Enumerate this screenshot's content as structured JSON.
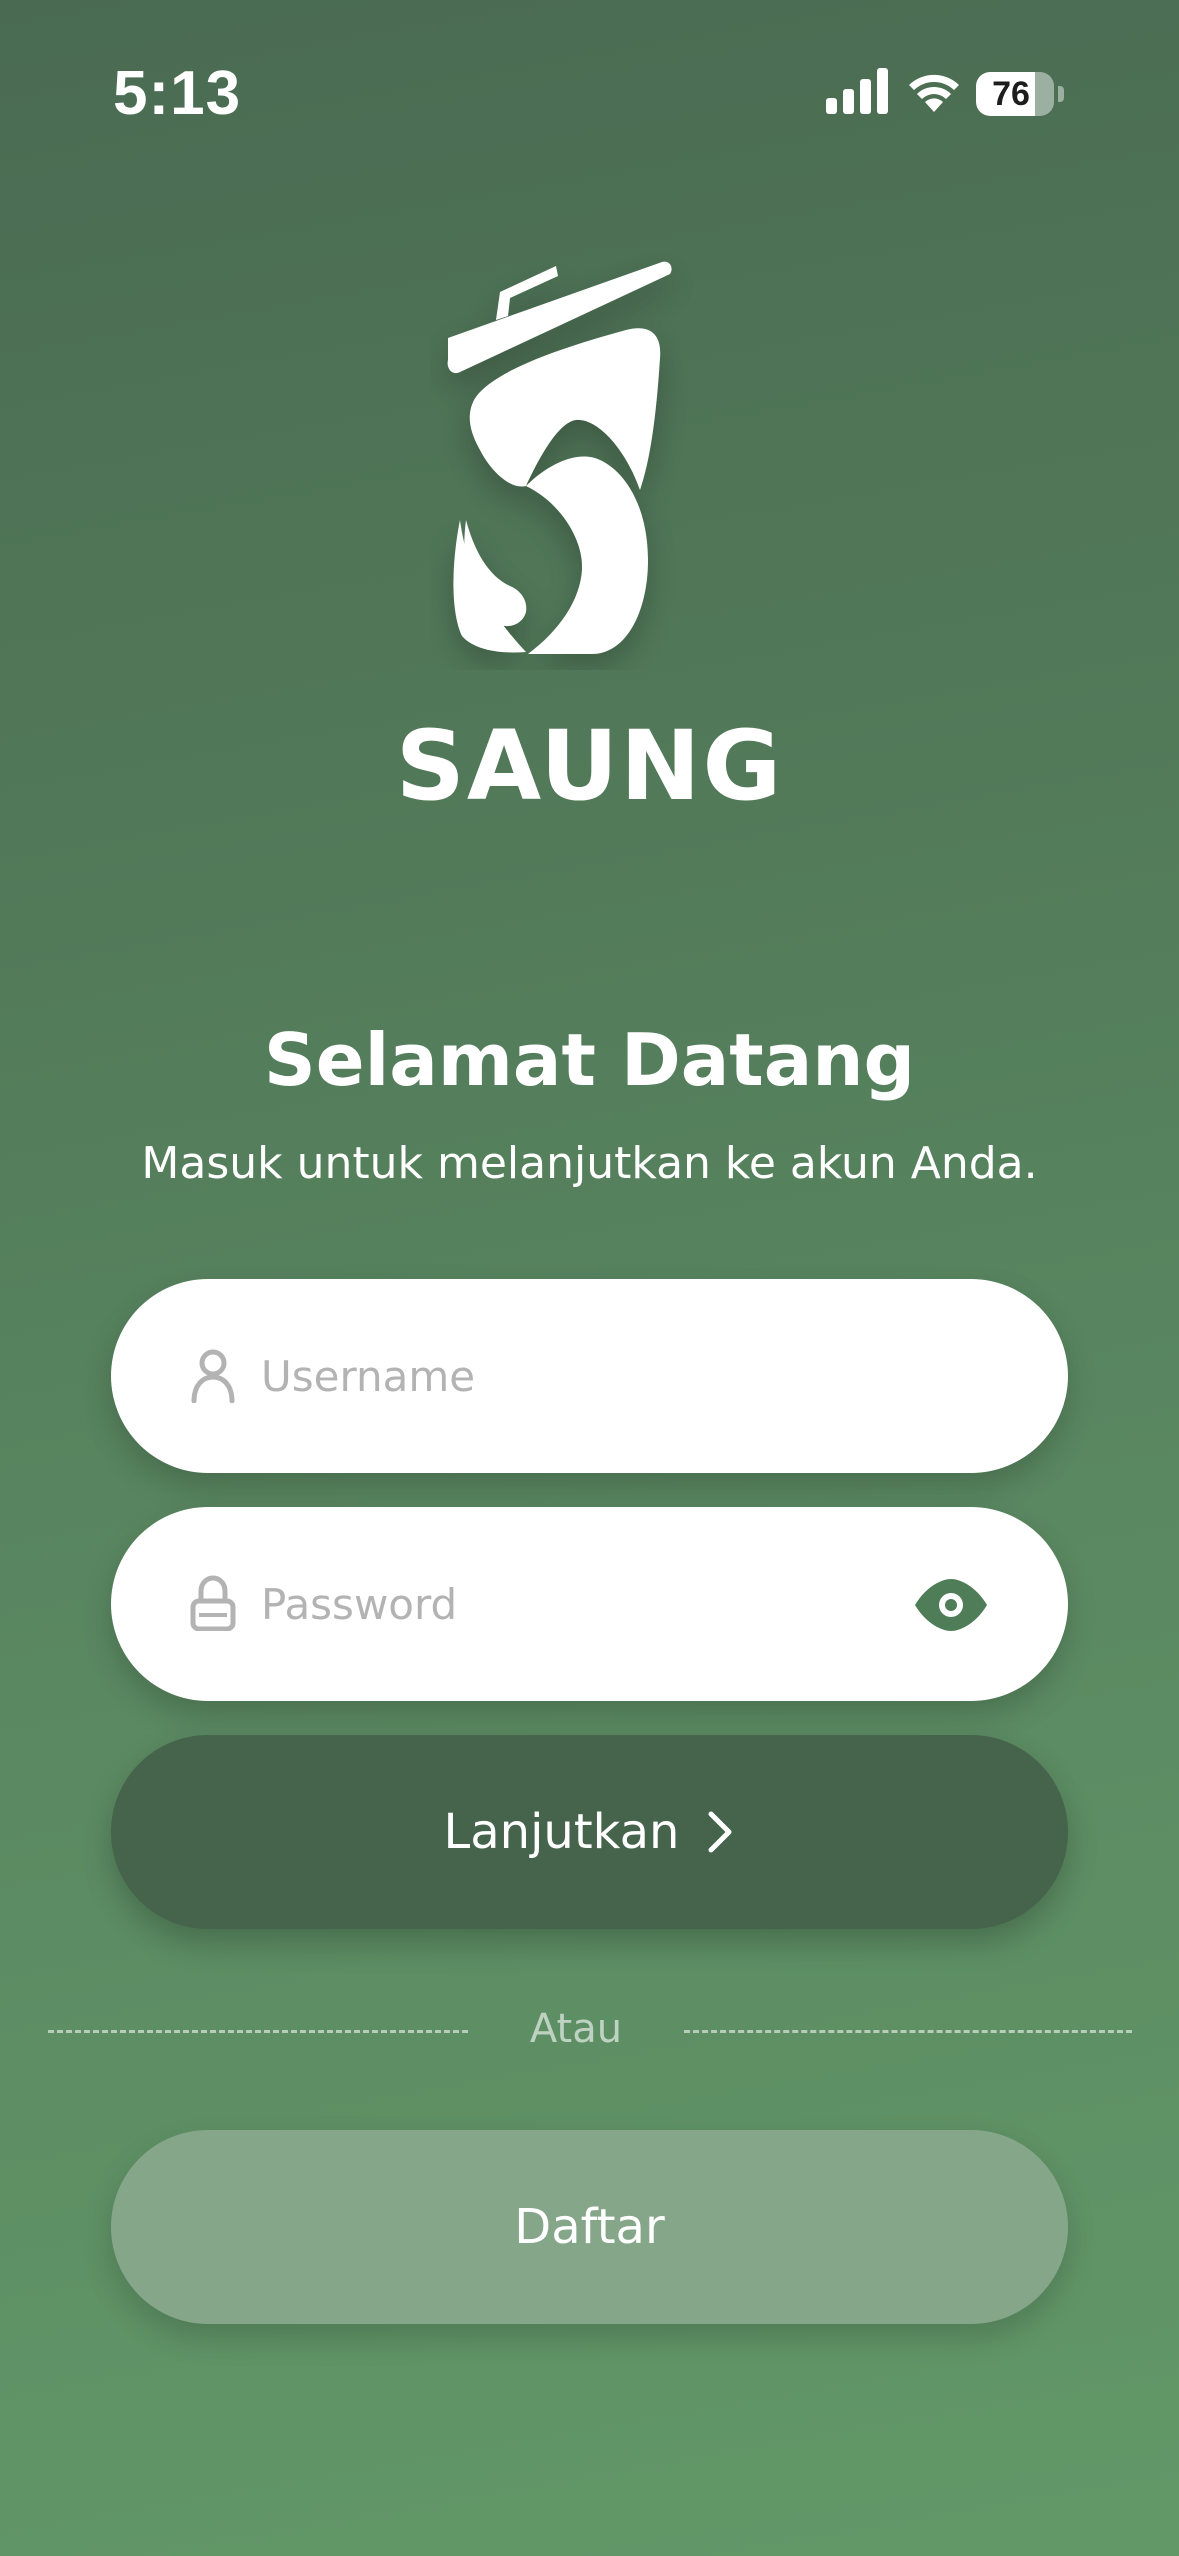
{
  "status_bar": {
    "time": "5:13",
    "battery_level": "76",
    "battery_fraction": 0.76
  },
  "brand": {
    "name": "SAUNG"
  },
  "welcome": {
    "title": "Selamat Datang",
    "subtitle": "Masuk untuk melanjutkan ke akun Anda."
  },
  "form": {
    "username_placeholder": "Username",
    "username_value": "",
    "password_placeholder": "Password",
    "password_value": ""
  },
  "actions": {
    "continue_label": "Lanjutkan",
    "divider_text": "Atau",
    "register_label": "Daftar"
  },
  "colors": {
    "accent": "#4f7d57",
    "primary_button": "#46634b",
    "secondary_button": "#86a68a"
  },
  "icons": {
    "username": "person-icon",
    "password": "lock-icon",
    "visibility": "eye-icon",
    "continue": "chevron-right-icon"
  }
}
